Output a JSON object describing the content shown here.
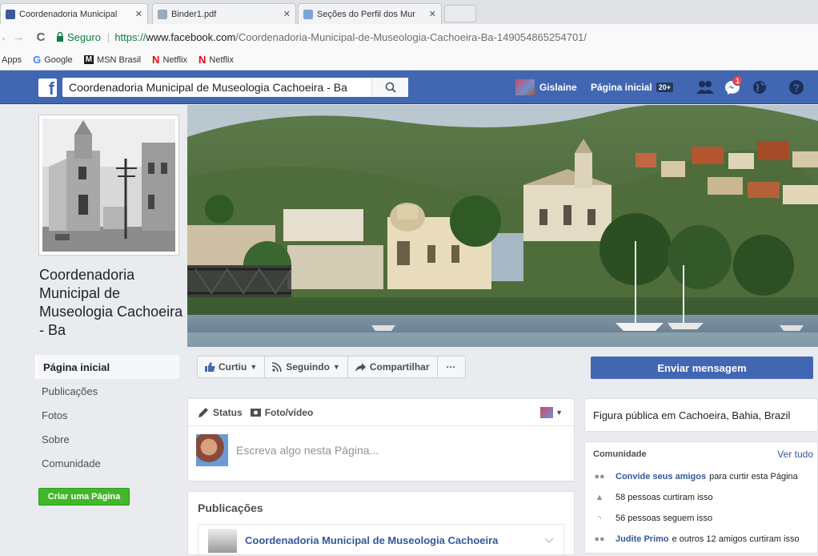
{
  "browser": {
    "tabs": [
      {
        "title": "Coordenadoria Municipal",
        "active": true
      },
      {
        "title": "Binder1.pdf",
        "active": false
      },
      {
        "title": "Seções do Perfil dos Mur",
        "active": false
      }
    ],
    "close_glyph": "✕",
    "back_glyph": "←",
    "forward_glyph": "→",
    "reload_glyph": "C",
    "secure_label": "Seguro",
    "url_proto": "https://",
    "url_host": "www.facebook.com",
    "url_path": "/Coordenadoria-Municipal-de-Museologia-Cachoeira-Ba-149054865254701/",
    "bookmarks": [
      {
        "label": "Apps",
        "icon": ""
      },
      {
        "label": "Google",
        "icon": "G"
      },
      {
        "label": "MSN Brasil",
        "icon": "M"
      },
      {
        "label": "Netflix",
        "icon": "N"
      },
      {
        "label": "Netflix",
        "icon": "N"
      }
    ]
  },
  "fb_header": {
    "logo": "f",
    "search_value": "Coordenadoria Municipal de Museologia Cachoeira - Ba",
    "user_name": "Gislaine",
    "home_label": "Página inicial",
    "home_count": "20+",
    "messages_badge": "1"
  },
  "page": {
    "name": "Coordenadoria Municipal de Museologia Cachoeira - Ba",
    "nav": [
      "Página inicial",
      "Publicações",
      "Fotos",
      "Sobre",
      "Comunidade"
    ],
    "create_page": "Criar uma Página"
  },
  "actions": {
    "like": "Curtiu",
    "follow": "Seguindo",
    "share": "Compartilhar",
    "more": "···",
    "send_message": "Enviar mensagem"
  },
  "composer": {
    "tab_status": "Status",
    "tab_photo": "Foto/vídeo",
    "placeholder": "Escreva algo nesta Página..."
  },
  "posts": {
    "title": "Publicações",
    "first_author": "Coordenadoria Municipal de Museologia Cachoeira"
  },
  "about": {
    "category": "Figura pública em Cachoeira, Bahia, Brazil"
  },
  "community": {
    "title": "Comunidade",
    "see_all": "Ver tudo",
    "invite_bold": "Convide seus amigos",
    "invite_rest": "para curtir esta Página",
    "likes": "58 pessoas curtiram isso",
    "follows": "56 pessoas seguem isso",
    "friend_bold": "Judite Primo",
    "friend_rest": "e outros 12 amigos curtiram isso"
  },
  "colors": {
    "fb_blue": "#4267b2",
    "green_button": "#42b72a",
    "link": "#365899",
    "badge_red": "#fa3e3e"
  }
}
